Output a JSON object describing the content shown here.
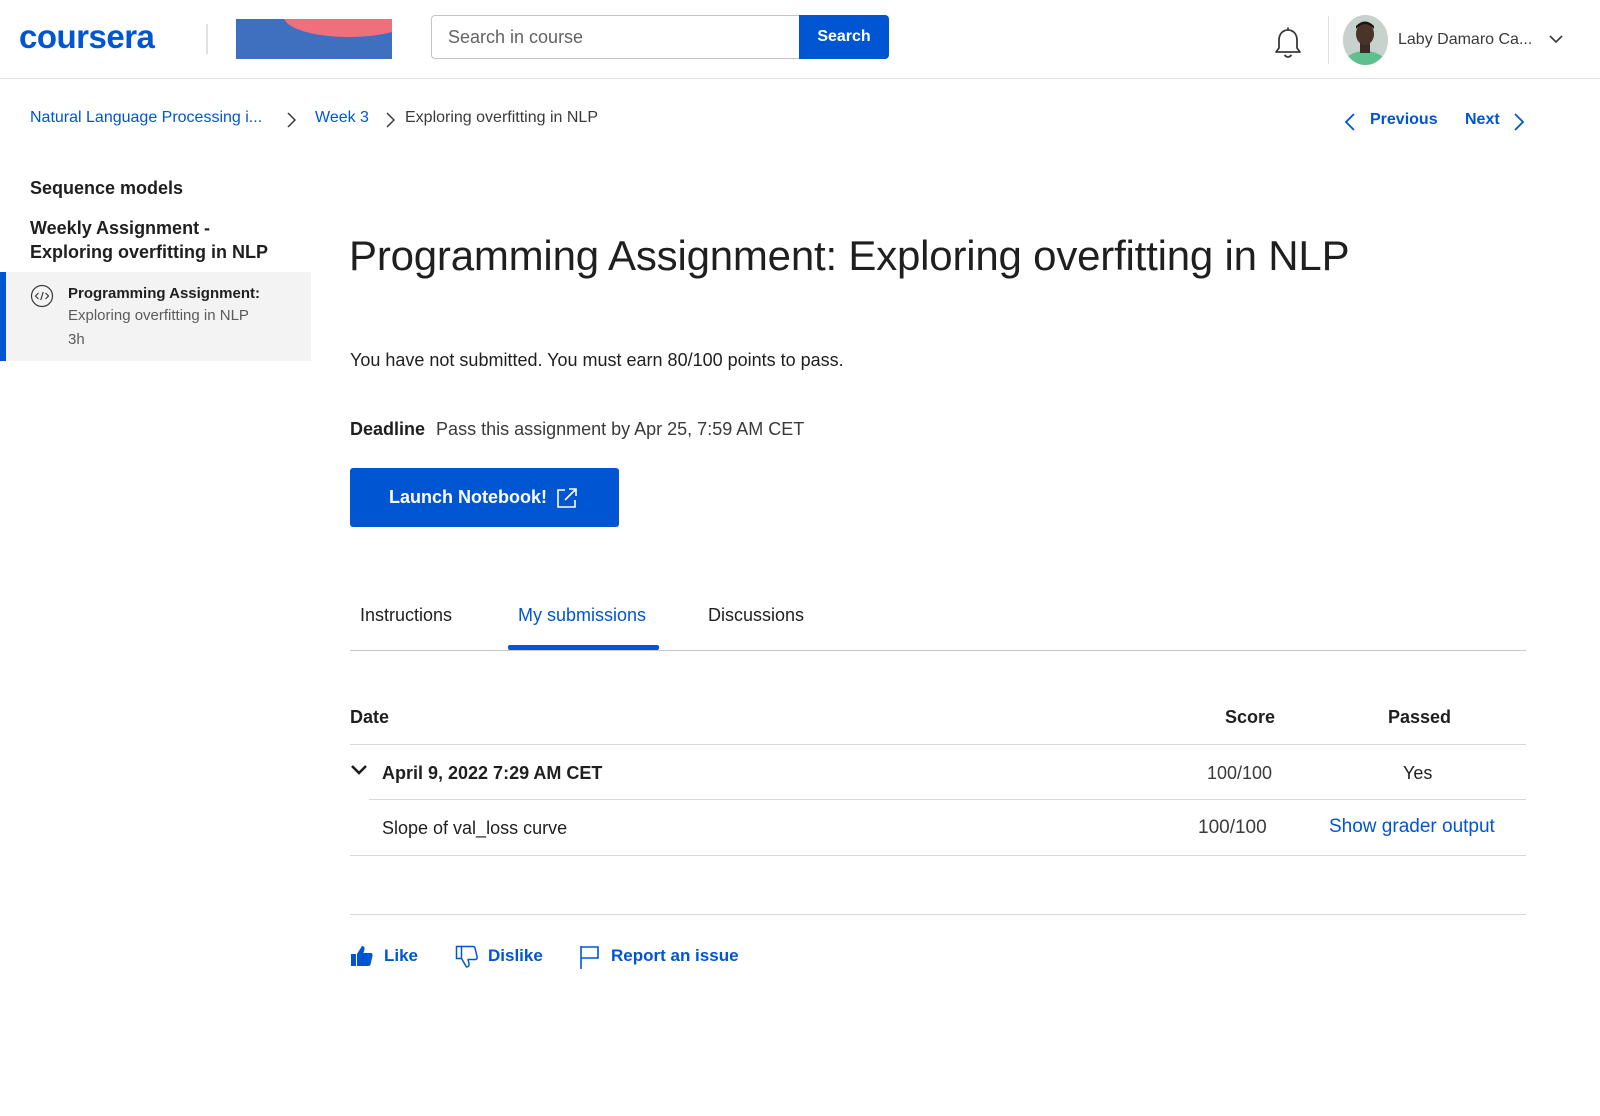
{
  "header": {
    "logo": "coursera",
    "search_placeholder": "Search in course",
    "search_button": "Search",
    "user_name": "Laby Damaro Ca..."
  },
  "breadcrumb": {
    "items": [
      "Natural Language Processing i...",
      "Week 3"
    ],
    "current": "Exploring overfitting in NLP"
  },
  "nav": {
    "previous": "Previous",
    "next": "Next"
  },
  "sidebar": {
    "section_title": "Sequence models",
    "group_title": "Weekly Assignment - Exploring overfitting in NLP",
    "items": [
      {
        "type_label": "Programming Assignment:",
        "title": "Exploring overfitting in NLP",
        "duration": "3h",
        "icon": "code-icon"
      }
    ]
  },
  "main": {
    "title": "Programming Assignment: Exploring overfitting in NLP",
    "status": "You have not submitted. You must earn 80/100 points to pass.",
    "deadline_label": "Deadline",
    "deadline_value": "Pass this assignment by Apr 25, 7:59 AM CET",
    "launch_button": "Launch Notebook!",
    "tabs": [
      "Instructions",
      "My submissions",
      "Discussions"
    ],
    "active_tab": "My submissions"
  },
  "submissions": {
    "headers": {
      "date": "Date",
      "score": "Score",
      "passed": "Passed"
    },
    "rows": [
      {
        "date": "April 9, 2022 7:29 AM CET",
        "score": "100/100",
        "passed": "Yes"
      }
    ],
    "details": [
      {
        "name": "Slope of val_loss curve",
        "score": "100/100",
        "action": "Show grader output"
      }
    ]
  },
  "feedback": {
    "like": "Like",
    "dislike": "Dislike",
    "report": "Report an issue"
  },
  "colors": {
    "brand": "#0056d2",
    "divider": "#e1e1e1",
    "sidebar_active_bg": "#f3f3f3"
  }
}
